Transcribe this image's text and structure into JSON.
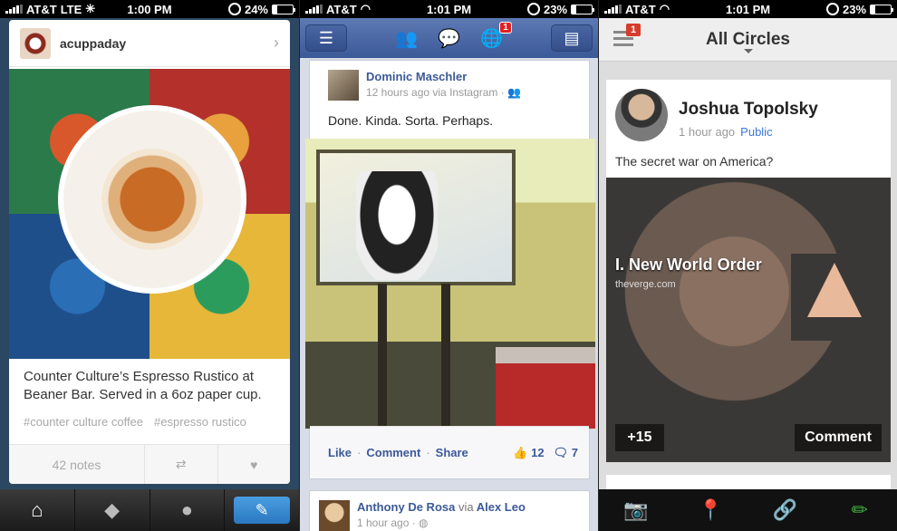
{
  "panels": {
    "tumblr": {
      "status": {
        "carrier": "AT&T",
        "network": "LTE",
        "time": "1:00 PM",
        "battery": "24%"
      },
      "post": {
        "username": "acuppaday",
        "caption": "Counter Culture’s Espresso Rustico at Beaner Bar. Served in a 6oz paper cup.",
        "tags": [
          "#counter culture coffee",
          "#espresso rustico"
        ],
        "notes": "42 notes"
      },
      "tabbar": {
        "icons": [
          "home-icon",
          "tag-icon",
          "account-icon",
          "compose-icon"
        ]
      }
    },
    "facebook": {
      "status": {
        "carrier": "AT&T",
        "time": "1:01 PM",
        "battery": "23%"
      },
      "nav": {
        "notification_count": "1"
      },
      "post": {
        "author": "Dominic Maschler",
        "meta": "12 hours ago via Instagram · ",
        "text": "Done. Kinda. Sorta. Perhaps.",
        "like": "Like",
        "comment": "Comment",
        "share": "Share",
        "like_count": "12",
        "comment_count": "7"
      },
      "next_post": {
        "author": "Anthony De Rosa",
        "via": "via",
        "via_name": "Alex Leo",
        "meta": "1 hour ago · "
      }
    },
    "gplus": {
      "status": {
        "carrier": "AT&T",
        "time": "1:01 PM",
        "battery": "23%"
      },
      "header": {
        "title": "All Circles",
        "badge": "1"
      },
      "post": {
        "author": "Joshua Topolsky",
        "time": "1 hour ago",
        "visibility": "Public",
        "text": "The secret war on America?",
        "link_title": "I. New World Order",
        "link_source": "theverge.com",
        "plus_count": "+15",
        "comment_label": "Comment"
      },
      "toolbar": {
        "icons": [
          "camera-icon",
          "location-icon",
          "link-icon",
          "pencil-icon"
        ]
      }
    }
  },
  "colors": {
    "tumblr_bg": "#2c4762",
    "facebook_blue": "#3b5998",
    "gplus_public": "#3a76d6"
  }
}
